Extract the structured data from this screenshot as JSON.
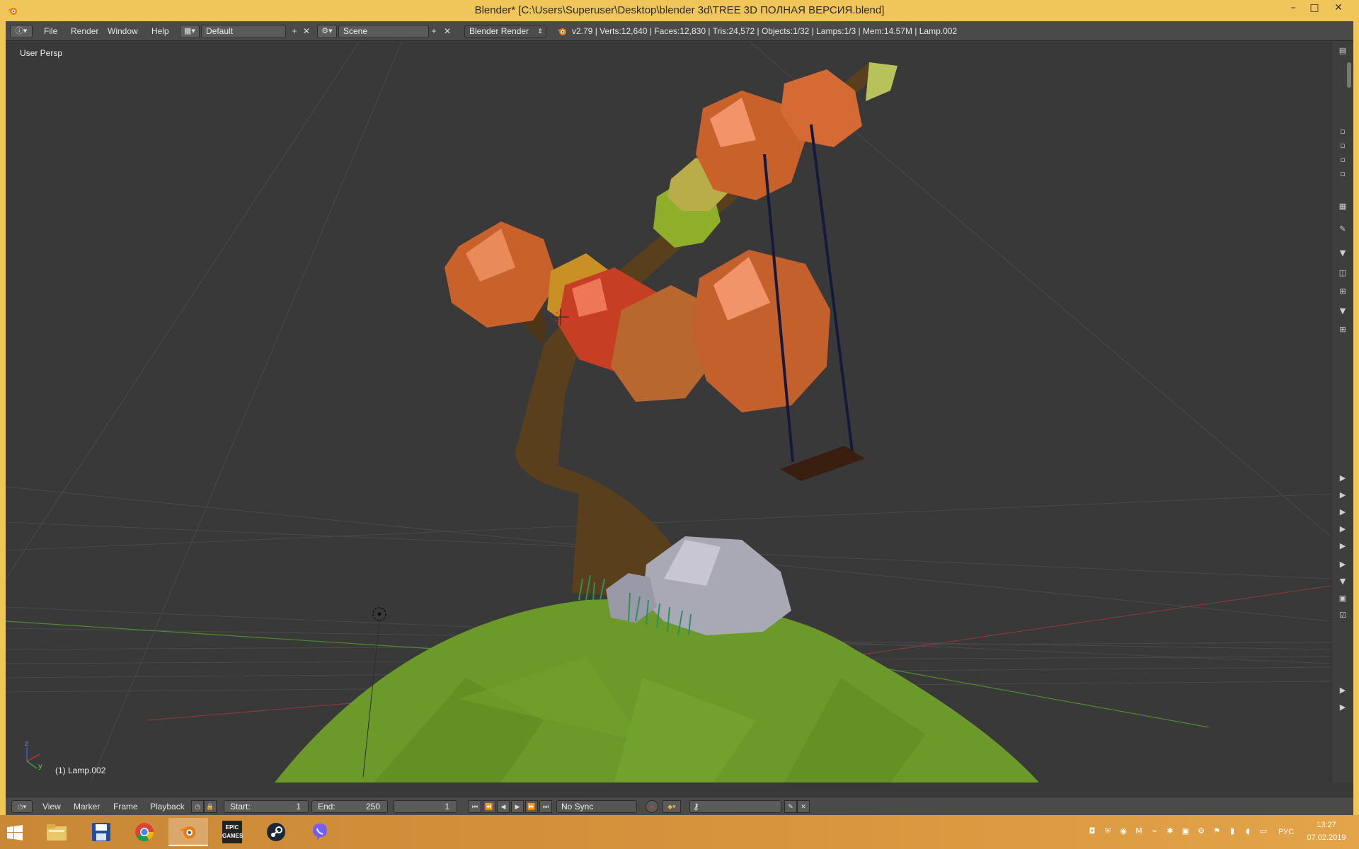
{
  "window": {
    "title": "Blender* [C:\\Users\\Superuser\\Desktop\\blender 3d\\TREE 3D ПОЛНАЯ ВЕРСИЯ.blend]",
    "minimize": "–",
    "maximize": "□",
    "close": "✕"
  },
  "topbar": {
    "menus": [
      "File",
      "Render",
      "Window",
      "Help"
    ],
    "screen_layout": "Default",
    "scene": "Scene",
    "render_engine": "Blender Render",
    "stats": "v2.79 | Verts:12,640 | Faces:12,830 | Tris:24,572 | Objects:1/32 | Lamps:1/3 | Mem:14.57M | Lamp.002"
  },
  "viewport": {
    "view_label": "User Persp",
    "active_object": "(1) Lamp.002",
    "axis": {
      "z": "z",
      "y": "y"
    }
  },
  "timeline": {
    "menus": [
      "View",
      "Marker",
      "Frame",
      "Playback"
    ],
    "start_label": "Start:",
    "start_value": "1",
    "end_label": "End:",
    "end_value": "250",
    "current_frame": "1",
    "sync": "No Sync"
  },
  "taskbar": {
    "apps": [
      "windows-start",
      "file-explorer",
      "save-disk",
      "chrome",
      "blender",
      "epic-games",
      "steam",
      "viber"
    ],
    "epic_label": "EPIC\nGAMES",
    "language": "РУС",
    "time": "13:27",
    "date": "07.02.2019"
  },
  "colors": {
    "titlebar": "#f0c55a",
    "taskbar": "#cc8a3a",
    "viewport_bg": "#393939",
    "header_bg": "#4a4a4a",
    "grass": "#6b9a2a",
    "trunk": "#5a3f1c"
  }
}
